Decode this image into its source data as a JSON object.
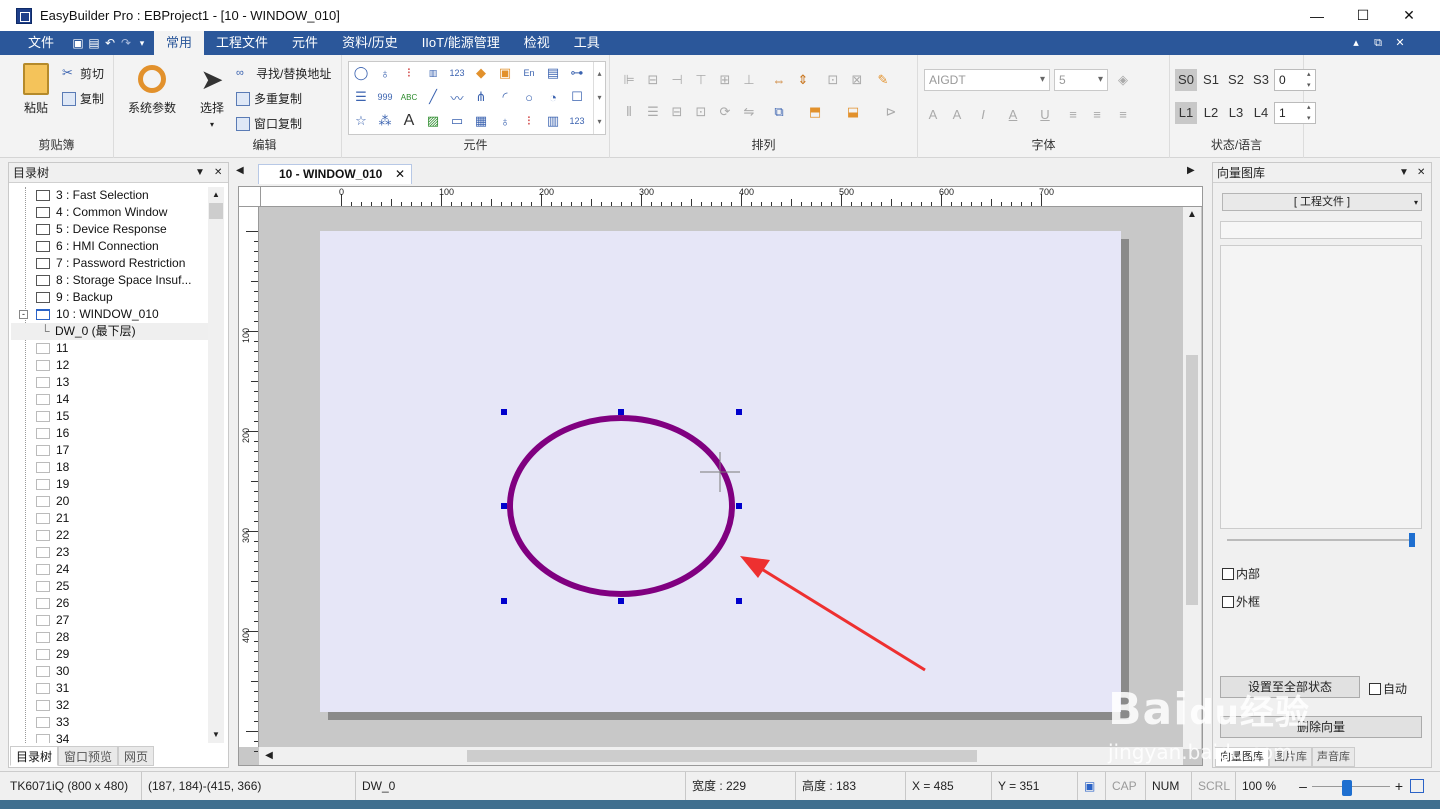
{
  "window": {
    "title": "EasyBuilder Pro : EBProject1 - [10 - WINDOW_010]",
    "controls": {
      "minimize": "—",
      "maximize": "☐",
      "close": "✕"
    }
  },
  "menu": {
    "file": "文件",
    "tabs": [
      "常用",
      "工程文件",
      "元件",
      "资料/历史",
      "IIoT/能源管理",
      "检视",
      "工具"
    ],
    "active": "常用",
    "doc_controls": [
      "▴",
      "⧉",
      "✕"
    ]
  },
  "ribbon": {
    "clipboard": {
      "label": "剪贴簿",
      "paste": "粘贴",
      "cut": "剪切",
      "copy": "复制"
    },
    "system": {
      "label": "系统参数"
    },
    "edit": {
      "label": "编辑",
      "select": "选择",
      "find": "寻找/替换地址",
      "multicopy": "多重复制",
      "wincopy": "窗口复制"
    },
    "objects": {
      "label": "元件"
    },
    "arrange": {
      "label": "排列"
    },
    "font": {
      "label": "字体",
      "font_name": "AIGDT",
      "font_size": "5"
    },
    "state": {
      "label": "状态/语言",
      "states": [
        "S0",
        "S1",
        "S2",
        "S3"
      ],
      "langs": [
        "L1",
        "L2",
        "L3",
        "L4"
      ],
      "state_value": "0",
      "lang_value": "1"
    }
  },
  "leftpanel": {
    "title": "目录树",
    "items": [
      {
        "label": "3 : Fast Selection",
        "kind": "win"
      },
      {
        "label": "4 : Common Window",
        "kind": "win"
      },
      {
        "label": "5 : Device Response",
        "kind": "win"
      },
      {
        "label": "6 : HMI Connection",
        "kind": "win"
      },
      {
        "label": "7 : Password Restriction",
        "kind": "win"
      },
      {
        "label": "8 : Storage Space Insuf...",
        "kind": "win"
      },
      {
        "label": "9 : Backup",
        "kind": "win"
      },
      {
        "label": "10 : WINDOW_010",
        "kind": "open"
      },
      {
        "label": "DW_0 (最下层)",
        "kind": "layer"
      },
      {
        "label": "11",
        "kind": "empty"
      },
      {
        "label": "12",
        "kind": "empty"
      },
      {
        "label": "13",
        "kind": "empty"
      },
      {
        "label": "14",
        "kind": "empty"
      },
      {
        "label": "15",
        "kind": "empty"
      },
      {
        "label": "16",
        "kind": "empty"
      },
      {
        "label": "17",
        "kind": "empty"
      },
      {
        "label": "18",
        "kind": "empty"
      },
      {
        "label": "19",
        "kind": "empty"
      },
      {
        "label": "20",
        "kind": "empty"
      },
      {
        "label": "21",
        "kind": "empty"
      },
      {
        "label": "22",
        "kind": "empty"
      },
      {
        "label": "23",
        "kind": "empty"
      },
      {
        "label": "24",
        "kind": "empty"
      },
      {
        "label": "25",
        "kind": "empty"
      },
      {
        "label": "26",
        "kind": "empty"
      },
      {
        "label": "27",
        "kind": "empty"
      },
      {
        "label": "28",
        "kind": "empty"
      },
      {
        "label": "29",
        "kind": "empty"
      },
      {
        "label": "30",
        "kind": "empty"
      },
      {
        "label": "31",
        "kind": "empty"
      },
      {
        "label": "32",
        "kind": "empty"
      },
      {
        "label": "33",
        "kind": "empty"
      },
      {
        "label": "34",
        "kind": "empty"
      }
    ],
    "bottom_tabs": [
      "目录树",
      "窗口预览",
      "网页"
    ]
  },
  "doc": {
    "tab": "10 - WINDOW_010",
    "ruler_h": [
      "0",
      "100",
      "200",
      "300",
      "400",
      "500",
      "600",
      "700"
    ],
    "ruler_v": [
      "100",
      "200",
      "300",
      "400"
    ]
  },
  "rightpanel": {
    "title": "向量图库",
    "combo": "[ 工程文件 ]",
    "inner": "内部",
    "outer": "外框",
    "set_all": "设置至全部状态",
    "auto": "自动",
    "delete": "删除向量",
    "tabs": [
      "向量图库",
      "图片库",
      "声音库"
    ]
  },
  "status": {
    "model": "TK6071iQ (800 x 480)",
    "coords": "(187, 184)-(415, 366)",
    "layer": "DW_0",
    "width": "宽度 : 229",
    "height": "高度 : 183",
    "x": "X = 485",
    "y": "Y = 351",
    "cap": "CAP",
    "num": "NUM",
    "scrl": "SCRL",
    "zoom": "100 %"
  },
  "colors": {
    "accent": "#2b579a",
    "ellipse": "#800080",
    "handles": "#0000cc",
    "arrow": "#ee3030"
  },
  "watermark": {
    "brand": "Bai",
    "brand2": "经验",
    "url": "jingyan.baidu.com"
  }
}
